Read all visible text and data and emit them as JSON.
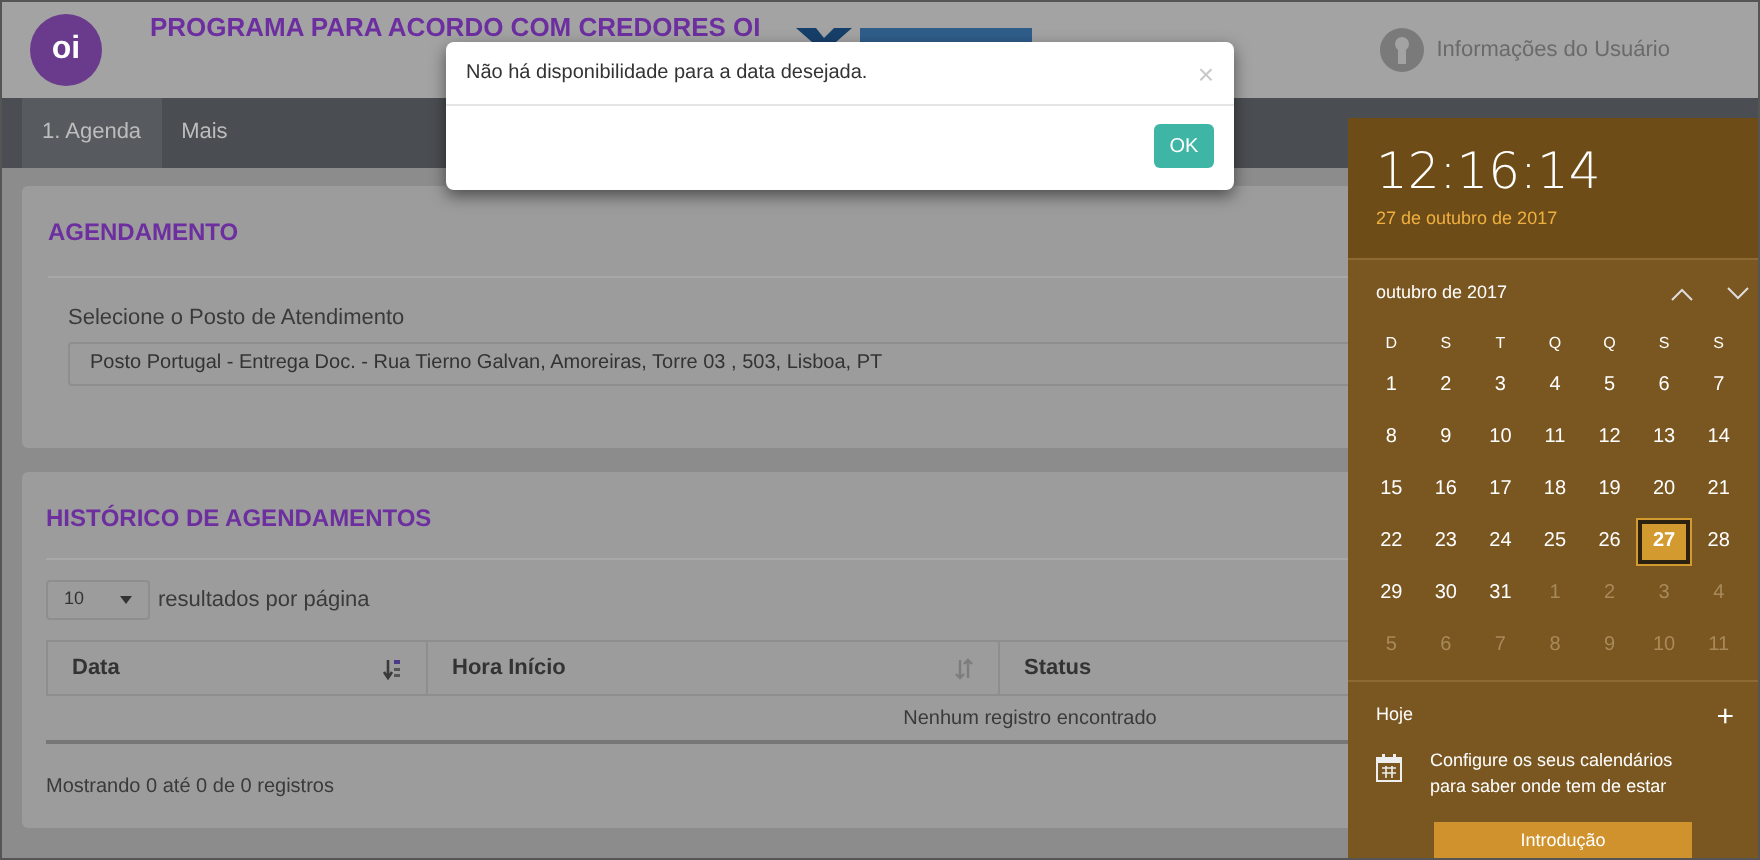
{
  "header": {
    "logo": "oi",
    "title": "PROGRAMA PARA ACORDO COM CREDORES OI",
    "user_menu": "Informações do Usuário"
  },
  "nav": [
    {
      "label": "1. Agenda",
      "selected": true
    },
    {
      "label": "Mais",
      "selected": false
    }
  ],
  "scheduling": {
    "title": "AGENDAMENTO",
    "field_label": "Selecione o Posto de Atendimento",
    "value": "Posto Portugal - Entrega Doc. - Rua Tierno Galvan, Amoreiras, Torre 03 , 503, Lisboa, PT"
  },
  "history": {
    "title": "HISTÓRICO DE AGENDAMENTOS",
    "page_size": "10",
    "page_size_label": "resultados por página",
    "columns": [
      {
        "label": "Data",
        "sorted": true
      },
      {
        "label": "Hora Início",
        "sorted": false
      },
      {
        "label": "Status"
      }
    ],
    "empty": "Nenhum registro encontrado",
    "footer": "Mostrando 0 até 0 de 0 registros"
  },
  "dialog": {
    "message": "Não há disponibilidade para a data desejada.",
    "close": "×",
    "button": "OK"
  },
  "clock": {
    "time": "12:16:14",
    "date": "27 de outubro de 2017",
    "month": "outubro de 2017",
    "weekdays": [
      "D",
      "S",
      "T",
      "Q",
      "Q",
      "S",
      "S"
    ],
    "days": [
      {
        "day": "1",
        "current": true,
        "selected": false
      },
      {
        "day": "2",
        "current": true,
        "selected": false
      },
      {
        "day": "3",
        "current": true,
        "selected": false
      },
      {
        "day": "4",
        "current": true,
        "selected": false
      },
      {
        "day": "5",
        "current": true,
        "selected": false
      },
      {
        "day": "6",
        "current": true,
        "selected": false
      },
      {
        "day": "7",
        "current": true,
        "selected": false
      },
      {
        "day": "8",
        "current": true,
        "selected": false
      },
      {
        "day": "9",
        "current": true,
        "selected": false
      },
      {
        "day": "10",
        "current": true,
        "selected": false
      },
      {
        "day": "11",
        "current": true,
        "selected": false
      },
      {
        "day": "12",
        "current": true,
        "selected": false
      },
      {
        "day": "13",
        "current": true,
        "selected": false
      },
      {
        "day": "14",
        "current": true,
        "selected": false
      },
      {
        "day": "15",
        "current": true,
        "selected": false
      },
      {
        "day": "16",
        "current": true,
        "selected": false
      },
      {
        "day": "17",
        "current": true,
        "selected": false
      },
      {
        "day": "18",
        "current": true,
        "selected": false
      },
      {
        "day": "19",
        "current": true,
        "selected": false
      },
      {
        "day": "20",
        "current": true,
        "selected": false
      },
      {
        "day": "21",
        "current": true,
        "selected": false
      },
      {
        "day": "22",
        "current": true,
        "selected": false
      },
      {
        "day": "23",
        "current": true,
        "selected": false
      },
      {
        "day": "24",
        "current": true,
        "selected": false
      },
      {
        "day": "25",
        "current": true,
        "selected": false
      },
      {
        "day": "26",
        "current": true,
        "selected": false
      },
      {
        "day": "27",
        "current": true,
        "selected": true
      },
      {
        "day": "28",
        "current": true,
        "selected": false
      },
      {
        "day": "29",
        "current": true,
        "selected": false
      },
      {
        "day": "30",
        "current": true,
        "selected": false
      },
      {
        "day": "31",
        "current": true,
        "selected": false
      },
      {
        "day": "1",
        "current": false,
        "selected": false
      },
      {
        "day": "2",
        "current": false,
        "selected": false
      },
      {
        "day": "3",
        "current": false,
        "selected": false
      },
      {
        "day": "4",
        "current": false,
        "selected": false
      },
      {
        "day": "5",
        "current": false,
        "selected": false
      },
      {
        "day": "6",
        "current": false,
        "selected": false
      },
      {
        "day": "7",
        "current": false,
        "selected": false
      },
      {
        "day": "8",
        "current": false,
        "selected": false
      },
      {
        "day": "9",
        "current": false,
        "selected": false
      },
      {
        "day": "10",
        "current": false,
        "selected": false
      },
      {
        "day": "11",
        "current": false,
        "selected": false
      }
    ],
    "today": "Hoje",
    "add": "+",
    "agenda_hint": "Configure os seus calendários para saber onde tem de estar",
    "button": "Introdução"
  }
}
